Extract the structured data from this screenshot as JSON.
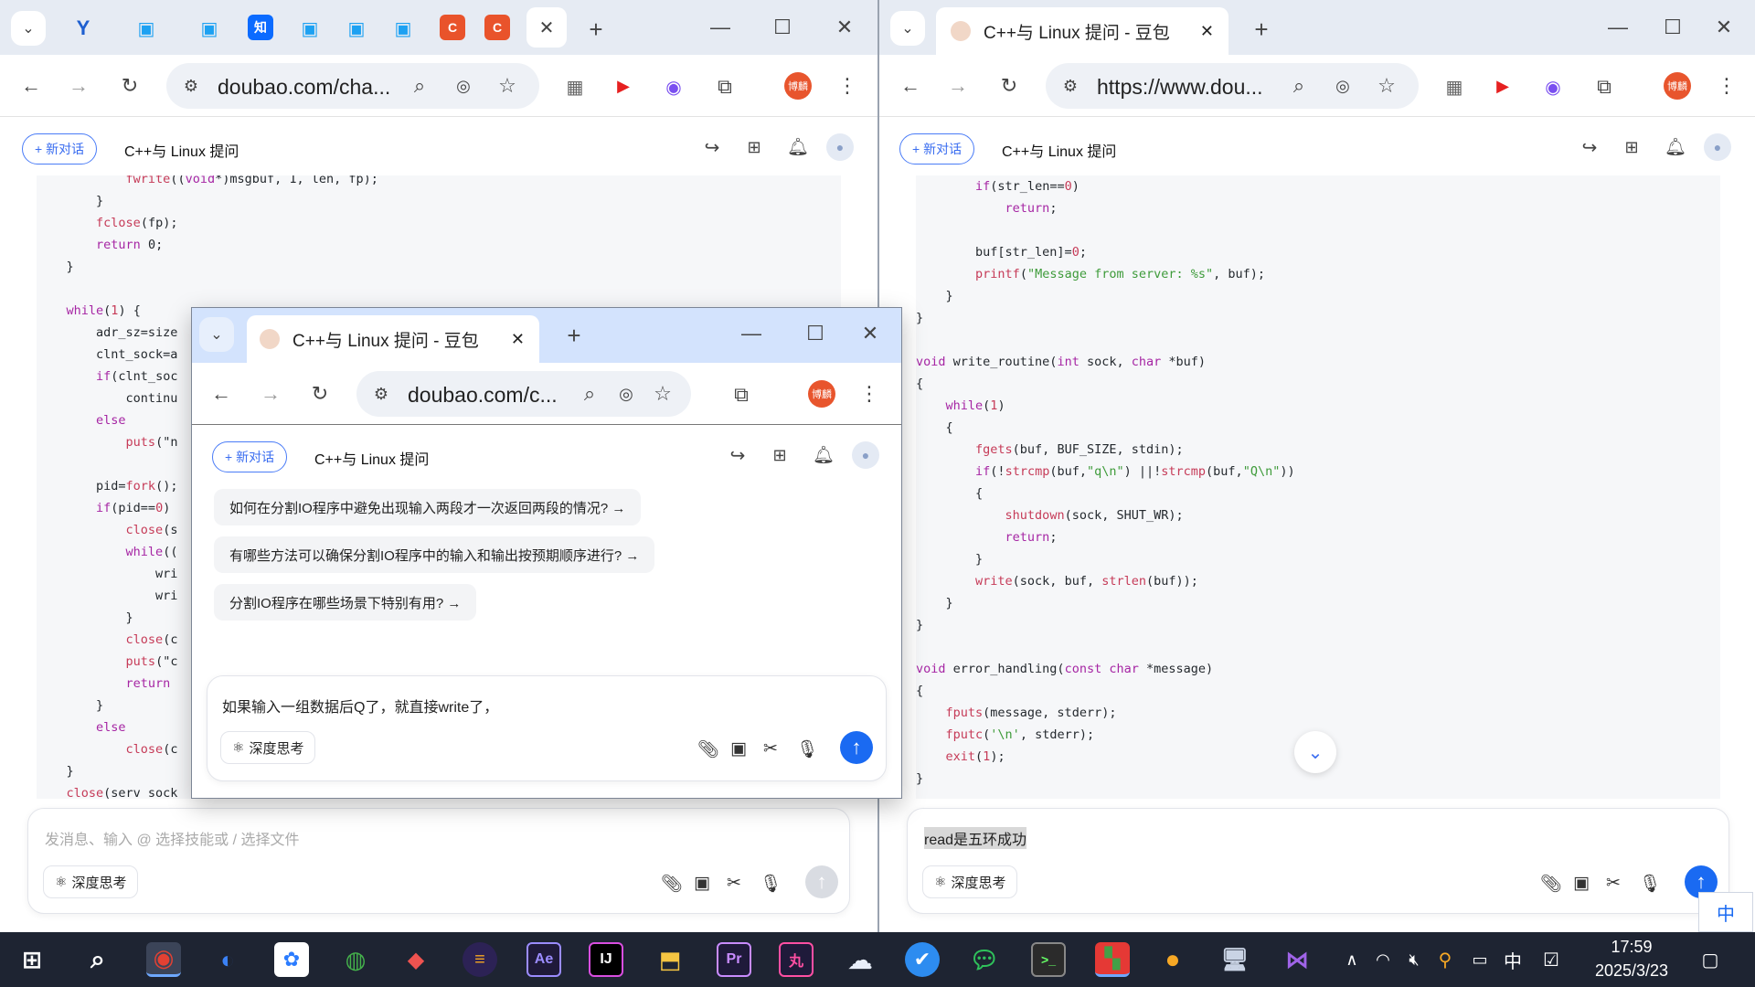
{
  "left_window": {
    "address": "doubao.com/cha...",
    "profile": "博麟",
    "new_chat": "+ 新对话",
    "conv_title": "C++与 Linux 提问",
    "code_lines": [
      "            fwrite((void*)msgbuf, 1, len, fp);",
      "        }",
      "        fclose(fp);",
      "        return 0;",
      "    }",
      "",
      "    while(1) {",
      "        adr_sz=size",
      "        clnt_sock=a",
      "        if(clnt_soc",
      "            continu",
      "        else",
      "            puts(\"n",
      "",
      "        pid=fork();",
      "        if(pid==0)",
      "            close(s",
      "            while((",
      "                wri",
      "                wri",
      "            }",
      "            close(c",
      "            puts(\"c",
      "            return",
      "        }",
      "        else",
      "            close(c",
      "    }",
      "    close(serv_sock"
    ],
    "input_placeholder": "发消息、输入 @ 选择技能或 / 选择文件",
    "deep_think": "深度思考"
  },
  "right_window": {
    "tab_title": "C++与 Linux 提问 - 豆包",
    "address": "https://www.dou...",
    "profile": "博麟",
    "new_chat": "+ 新对话",
    "conv_title": "C++与 Linux 提问",
    "code_lines": [
      "        if(str_len==0)",
      "            return;",
      "",
      "        buf[str_len]=0;",
      "        printf(\"Message from server: %s\", buf);",
      "    }",
      "}",
      "",
      "void write_routine(int sock, char *buf)",
      "{",
      "    while(1)",
      "    {",
      "        fgets(buf, BUF_SIZE, stdin);",
      "        if(!strcmp(buf,\"q\\n\") ||!strcmp(buf,\"Q\\n\"))",
      "        {",
      "            shutdown(sock, SHUT_WR);",
      "            return;",
      "        }",
      "        write(sock, buf, strlen(buf));",
      "    }",
      "}",
      "",
      "void error_handling(const char *message)",
      "{",
      "    fputs(message, stderr);",
      "    fputc('\\n', stderr);",
      "    exit(1);",
      "}"
    ],
    "input_value": "read是五环成功",
    "deep_think": "深度思考"
  },
  "popup_window": {
    "tab_title": "C++与 Linux 提问 - 豆包",
    "address": "doubao.com/c...",
    "profile": "博麟",
    "new_chat": "+ 新对话",
    "conv_title": "C++与 Linux 提问",
    "suggestions": [
      "如何在分割IO程序中避免出现输入两段才一次返回两段的情况?  →",
      "有哪些方法可以确保分割IO程序中的输入和输出按预期顺序进行?  →",
      "分割IO程序在哪些场景下特别有用?  →"
    ],
    "input_value": "如果输入一组数据后Q了，就直接write了，",
    "deep_think": "深度思考"
  },
  "ime_indicator": "中",
  "taskbar": {
    "time": "17:59",
    "date": "2025/3/23",
    "ime": "中"
  },
  "colors": {
    "accent": "#1a6af2",
    "tabstrip": "#d3e3fd",
    "taskbar": "#1e2432"
  }
}
